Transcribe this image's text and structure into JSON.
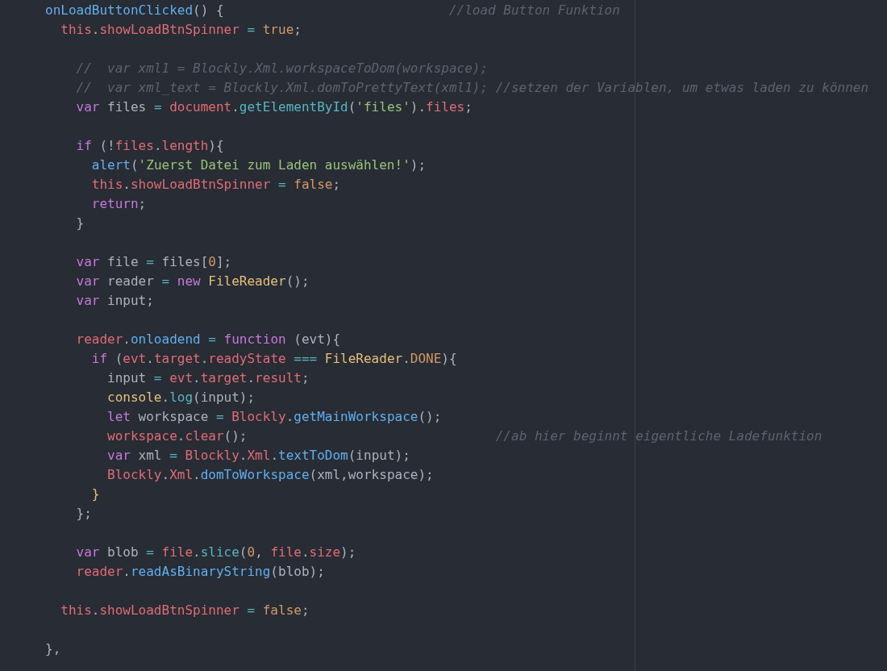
{
  "code_blocks": [
    {
      "lines": [
        {
          "tokens": [
            {
              "text": "onLoadButtonClicked",
              "kind": "function"
            },
            {
              "text": "() {",
              "kind": "punct"
            },
            {
              "text": "                             //load Button Funktion",
              "kind": "comment"
            }
          ]
        },
        {
          "tokens": [
            {
              "text": "  this",
              "kind": "variable"
            },
            {
              "text": ".",
              "kind": "punct"
            },
            {
              "text": "showLoadBtnSpinner",
              "kind": "variable"
            },
            {
              "text": " = ",
              "kind": "operator"
            },
            {
              "text": "true",
              "kind": "constant"
            },
            {
              "text": ";",
              "kind": "punct"
            }
          ]
        }
      ]
    },
    {
      "lines": [
        {
          "tokens": [
            {
              "text": "    //  var xml1 = Blockly.Xml.workspaceToDom(workspace);",
              "kind": "comment"
            }
          ]
        },
        {
          "tokens": [
            {
              "text": "    //  var xml_text = Blockly.Xml.domToPrettyText(xml1); //setzen der Variablen, um etwas laden zu können",
              "kind": "comment"
            }
          ]
        },
        {
          "tokens": [
            {
              "text": "    var",
              "kind": "keyword"
            },
            {
              "text": " files ",
              "kind": "punct"
            },
            {
              "text": "= ",
              "kind": "operator"
            },
            {
              "text": "document",
              "kind": "variable"
            },
            {
              "text": ".",
              "kind": "punct"
            },
            {
              "text": "getElementById",
              "kind": "operator"
            },
            {
              "text": "(",
              "kind": "punct"
            },
            {
              "text": "'files'",
              "kind": "string"
            },
            {
              "text": ").",
              "kind": "punct"
            },
            {
              "text": "files",
              "kind": "variable"
            },
            {
              "text": ";",
              "kind": "punct"
            }
          ]
        }
      ]
    },
    {
      "lines": [
        {
          "tokens": [
            {
              "text": "    if",
              "kind": "keyword"
            },
            {
              "text": " (!",
              "kind": "punct"
            },
            {
              "text": "files",
              "kind": "variable"
            },
            {
              "text": ".",
              "kind": "punct"
            },
            {
              "text": "length",
              "kind": "variable"
            },
            {
              "text": "){",
              "kind": "punct"
            }
          ]
        },
        {
          "tokens": [
            {
              "text": "      alert",
              "kind": "function"
            },
            {
              "text": "(",
              "kind": "punct"
            },
            {
              "text": "'Zuerst Datei zum Laden auswählen!'",
              "kind": "string"
            },
            {
              "text": ");",
              "kind": "punct"
            }
          ]
        },
        {
          "tokens": [
            {
              "text": "      this",
              "kind": "variable"
            },
            {
              "text": ".",
              "kind": "punct"
            },
            {
              "text": "showLoadBtnSpinner",
              "kind": "variable"
            },
            {
              "text": " = ",
              "kind": "operator"
            },
            {
              "text": "false",
              "kind": "constant"
            },
            {
              "text": ";",
              "kind": "punct"
            }
          ]
        },
        {
          "tokens": [
            {
              "text": "      return",
              "kind": "keyword"
            },
            {
              "text": ";",
              "kind": "punct"
            }
          ]
        },
        {
          "tokens": [
            {
              "text": "    }",
              "kind": "punct"
            }
          ]
        }
      ]
    },
    {
      "lines": [
        {
          "tokens": [
            {
              "text": "    var",
              "kind": "keyword"
            },
            {
              "text": " file ",
              "kind": "punct"
            },
            {
              "text": "=",
              "kind": "operator"
            },
            {
              "text": " files[",
              "kind": "punct"
            },
            {
              "text": "0",
              "kind": "constant"
            },
            {
              "text": "];",
              "kind": "punct"
            }
          ]
        },
        {
          "tokens": [
            {
              "text": "    var",
              "kind": "keyword"
            },
            {
              "text": " reader ",
              "kind": "punct"
            },
            {
              "text": "= ",
              "kind": "operator"
            },
            {
              "text": "new ",
              "kind": "keyword"
            },
            {
              "text": "FileReader",
              "kind": "class"
            },
            {
              "text": "();",
              "kind": "punct"
            }
          ]
        },
        {
          "tokens": [
            {
              "text": "    var",
              "kind": "keyword"
            },
            {
              "text": " input;",
              "kind": "punct"
            }
          ]
        }
      ]
    },
    {
      "lines": [
        {
          "tokens": [
            {
              "text": "    reader",
              "kind": "variable"
            },
            {
              "text": ".",
              "kind": "punct"
            },
            {
              "text": "onloadend",
              "kind": "function"
            },
            {
              "text": " = ",
              "kind": "operator"
            },
            {
              "text": "function",
              "kind": "keyword"
            },
            {
              "text": " (evt){",
              "kind": "punct"
            }
          ]
        },
        {
          "tokens": [
            {
              "text": "      if",
              "kind": "keyword"
            },
            {
              "text": " (",
              "kind": "punct"
            },
            {
              "text": "evt",
              "kind": "variable"
            },
            {
              "text": ".",
              "kind": "punct"
            },
            {
              "text": "target",
              "kind": "variable"
            },
            {
              "text": ".",
              "kind": "punct"
            },
            {
              "text": "readyState",
              "kind": "variable"
            },
            {
              "text": " === ",
              "kind": "operator"
            },
            {
              "text": "FileReader",
              "kind": "class"
            },
            {
              "text": ".",
              "kind": "punct"
            },
            {
              "text": "DONE",
              "kind": "constant"
            },
            {
              "text": "){",
              "kind": "punct"
            }
          ]
        },
        {
          "tokens": [
            {
              "text": "        input ",
              "kind": "punct"
            },
            {
              "text": "= ",
              "kind": "operator"
            },
            {
              "text": "evt",
              "kind": "variable"
            },
            {
              "text": ".",
              "kind": "punct"
            },
            {
              "text": "target",
              "kind": "variable"
            },
            {
              "text": ".",
              "kind": "punct"
            },
            {
              "text": "result",
              "kind": "variable"
            },
            {
              "text": ";",
              "kind": "punct"
            }
          ]
        },
        {
          "tokens": [
            {
              "text": "        console",
              "kind": "class"
            },
            {
              "text": ".",
              "kind": "punct"
            },
            {
              "text": "log",
              "kind": "operator"
            },
            {
              "text": "(input);",
              "kind": "punct"
            }
          ]
        },
        {
          "tokens": [
            {
              "text": "        let",
              "kind": "keyword"
            },
            {
              "text": " workspace ",
              "kind": "punct"
            },
            {
              "text": "= ",
              "kind": "operator"
            },
            {
              "text": "Blockly",
              "kind": "variable"
            },
            {
              "text": ".",
              "kind": "punct"
            },
            {
              "text": "getMainWorkspace",
              "kind": "function"
            },
            {
              "text": "();",
              "kind": "punct"
            }
          ]
        },
        {
          "tokens": [
            {
              "text": "        workspace",
              "kind": "variable"
            },
            {
              "text": ".",
              "kind": "punct"
            },
            {
              "text": "clear",
              "kind": "variable"
            },
            {
              "text": "();",
              "kind": "punct"
            },
            {
              "text": "                                //ab hier beginnt eigentliche Ladefunktion",
              "kind": "comment"
            }
          ]
        },
        {
          "tokens": [
            {
              "text": "        var",
              "kind": "keyword"
            },
            {
              "text": " xml ",
              "kind": "punct"
            },
            {
              "text": "= ",
              "kind": "operator"
            },
            {
              "text": "Blockly",
              "kind": "variable"
            },
            {
              "text": ".",
              "kind": "punct"
            },
            {
              "text": "Xml",
              "kind": "variable"
            },
            {
              "text": ".",
              "kind": "punct"
            },
            {
              "text": "textToDom",
              "kind": "function"
            },
            {
              "text": "(input);",
              "kind": "punct"
            }
          ]
        },
        {
          "tokens": [
            {
              "text": "        Blockly",
              "kind": "variable"
            },
            {
              "text": ".",
              "kind": "punct"
            },
            {
              "text": "Xml",
              "kind": "variable"
            },
            {
              "text": ".",
              "kind": "punct"
            },
            {
              "text": "domToWorkspace",
              "kind": "function"
            },
            {
              "text": "(xml,workspace);",
              "kind": "punct"
            }
          ]
        },
        {
          "tokens": [
            {
              "text": "      }",
              "kind": "class"
            }
          ]
        },
        {
          "tokens": [
            {
              "text": "    };",
              "kind": "punct"
            }
          ]
        }
      ]
    },
    {
      "lines": [
        {
          "tokens": [
            {
              "text": "    var",
              "kind": "keyword"
            },
            {
              "text": " blob ",
              "kind": "punct"
            },
            {
              "text": "= ",
              "kind": "operator"
            },
            {
              "text": "file",
              "kind": "variable"
            },
            {
              "text": ".",
              "kind": "punct"
            },
            {
              "text": "slice",
              "kind": "operator"
            },
            {
              "text": "(",
              "kind": "punct"
            },
            {
              "text": "0",
              "kind": "constant"
            },
            {
              "text": ", ",
              "kind": "punct"
            },
            {
              "text": "file",
              "kind": "variable"
            },
            {
              "text": ".",
              "kind": "punct"
            },
            {
              "text": "size",
              "kind": "variable"
            },
            {
              "text": ");",
              "kind": "punct"
            }
          ]
        },
        {
          "tokens": [
            {
              "text": "    reader",
              "kind": "variable"
            },
            {
              "text": ".",
              "kind": "punct"
            },
            {
              "text": "readAsBinaryString",
              "kind": "function"
            },
            {
              "text": "(blob);",
              "kind": "punct"
            }
          ]
        }
      ]
    },
    {
      "lines": [
        {
          "tokens": [
            {
              "text": "  this",
              "kind": "variable"
            },
            {
              "text": ".",
              "kind": "punct"
            },
            {
              "text": "showLoadBtnSpinner",
              "kind": "variable"
            },
            {
              "text": " = ",
              "kind": "operator"
            },
            {
              "text": "false",
              "kind": "constant"
            },
            {
              "text": ";",
              "kind": "punct"
            }
          ]
        }
      ]
    },
    {
      "lines": [
        {
          "tokens": [
            {
              "text": "},",
              "kind": "punct"
            }
          ]
        }
      ]
    }
  ]
}
